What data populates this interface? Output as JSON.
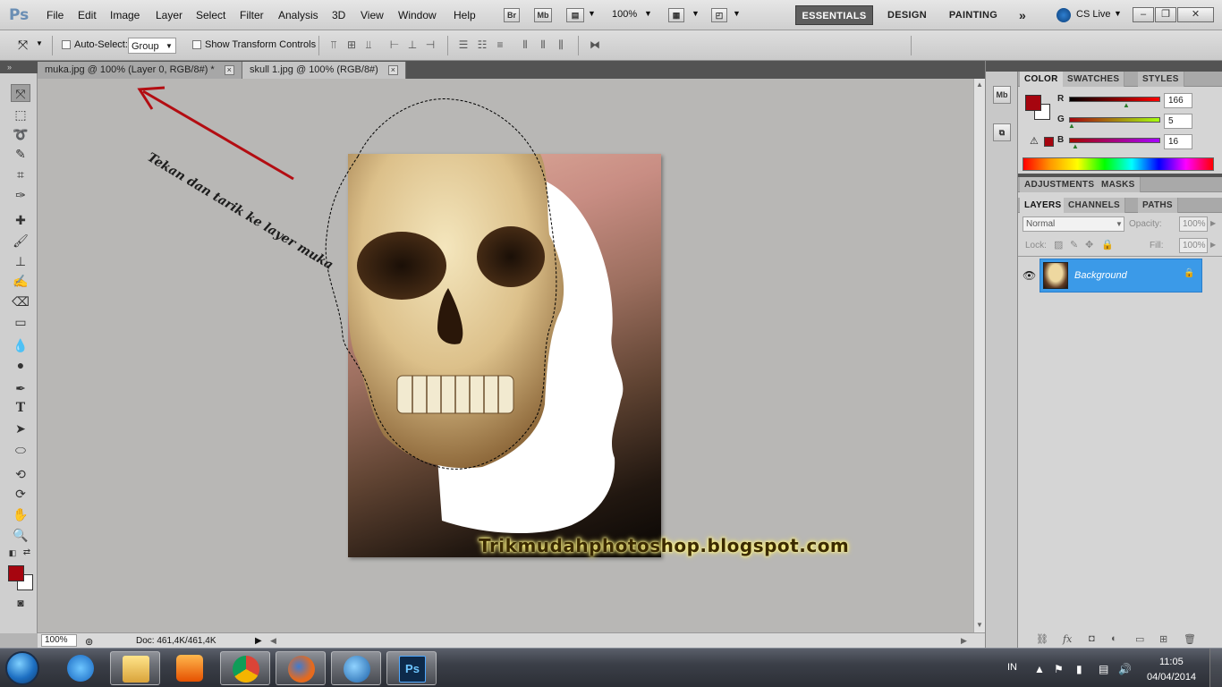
{
  "app": {
    "logo": "Ps"
  },
  "menu": [
    "File",
    "Edit",
    "Image",
    "Layer",
    "Select",
    "Filter",
    "Analysis",
    "3D",
    "View",
    "Window",
    "Help"
  ],
  "menubar_icons": {
    "bridge": "Br",
    "minibridge": "Mb",
    "zoom": "100%"
  },
  "workspaces": {
    "essentials": "ESSENTIALS",
    "design": "DESIGN",
    "painting": "PAINTING",
    "more": "»",
    "cslive": "CS Live"
  },
  "options": {
    "auto_select_label": "Auto-Select:",
    "auto_select_value": "Group",
    "show_transform_label": "Show Transform Controls"
  },
  "tabs": [
    {
      "label": "muka.jpg @ 100% (Layer 0, RGB/8#) *",
      "close": "×"
    },
    {
      "label": "skull 1.jpg @ 100% (RGB/8#)",
      "close": "×"
    }
  ],
  "annotation": "Tekan dan tarik ke layer muka",
  "watermark": "Trikmudahphotoshop.blogspot.com",
  "status": {
    "zoom": "100%",
    "doc": "Doc: 461,4K/461,4K"
  },
  "dock": {
    "mb": "Mb"
  },
  "color_panel": {
    "tabs": [
      "COLOR",
      "SWATCHES",
      "STYLES"
    ],
    "r_label": "R",
    "g_label": "G",
    "b_label": "B",
    "r": "166",
    "g": "5",
    "b": "16",
    "fg_color": "#a6050f"
  },
  "adjust_panel": {
    "tabs": [
      "ADJUSTMENTS",
      "MASKS"
    ]
  },
  "layers_panel": {
    "tabs": [
      "LAYERS",
      "CHANNELS",
      "PATHS"
    ],
    "blend_mode": "Normal",
    "opacity_label": "Opacity:",
    "opacity": "100%",
    "lock_label": "Lock:",
    "fill_label": "Fill:",
    "fill": "100%",
    "layers": [
      {
        "name": "Background"
      }
    ]
  },
  "taskbar": {
    "lang": "IN",
    "time": "11:05",
    "date": "04/04/2014"
  }
}
